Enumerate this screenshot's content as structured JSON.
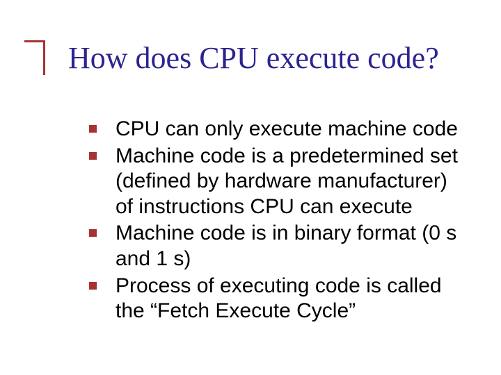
{
  "slide": {
    "title": "How does CPU execute code?",
    "bullets": [
      "CPU can only execute machine code",
      "Machine code is a predetermined set (defined by hardware manufacturer) of instructions CPU can execute",
      "Machine code is in binary format (0 s and 1 s)",
      "Process of executing code is called the “Fetch Execute Cycle”"
    ]
  }
}
